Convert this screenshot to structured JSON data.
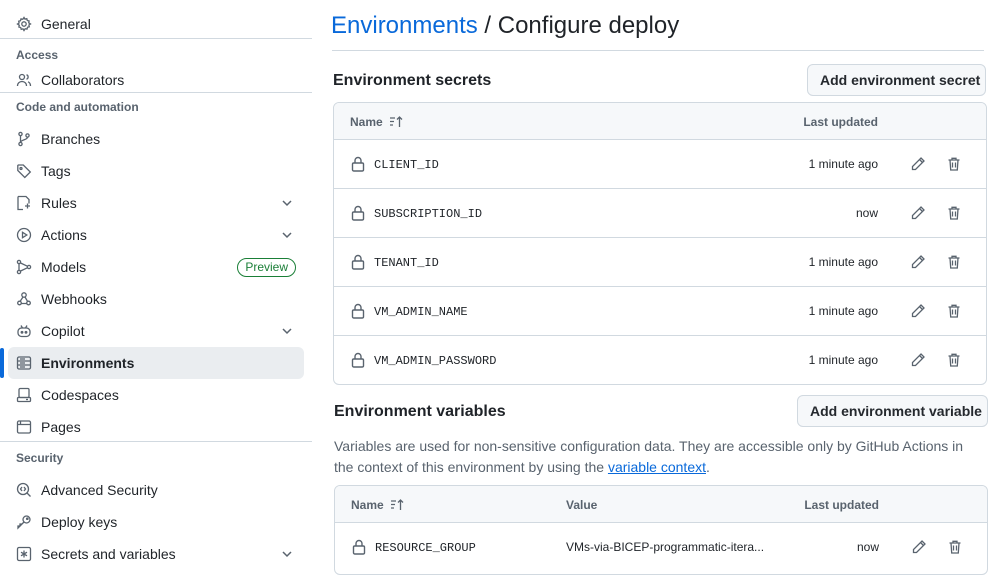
{
  "sidebar": {
    "items": [
      {
        "label": "General",
        "icon": "gear-icon"
      },
      {
        "label": "Collaborators",
        "icon": "people-icon"
      },
      {
        "label": "Branches",
        "icon": "git-branch-icon"
      },
      {
        "label": "Tags",
        "icon": "tag-icon"
      },
      {
        "label": "Rules",
        "icon": "rules-icon"
      },
      {
        "label": "Actions",
        "icon": "play-icon"
      },
      {
        "label": "Models",
        "icon": "models-icon",
        "badge": "Preview"
      },
      {
        "label": "Webhooks",
        "icon": "webhook-icon"
      },
      {
        "label": "Copilot",
        "icon": "copilot-icon"
      },
      {
        "label": "Environments",
        "icon": "server-icon"
      },
      {
        "label": "Codespaces",
        "icon": "codespaces-icon"
      },
      {
        "label": "Pages",
        "icon": "browser-icon"
      },
      {
        "label": "Advanced Security",
        "icon": "codescan-icon"
      },
      {
        "label": "Deploy keys",
        "icon": "key-icon"
      },
      {
        "label": "Secrets and variables",
        "icon": "asterisk-icon"
      }
    ],
    "groups": {
      "access": "Access",
      "code_automation": "Code and automation",
      "security": "Security"
    }
  },
  "header": {
    "crumb": "Environments",
    "separator": " / ",
    "title": "Configure deploy"
  },
  "secrets": {
    "title": "Environment secrets",
    "add_label": "Add environment secret",
    "col_name": "Name",
    "col_updated": "Last updated",
    "rows": [
      {
        "name": "CLIENT_ID",
        "updated": "1 minute ago"
      },
      {
        "name": "SUBSCRIPTION_ID",
        "updated": "now"
      },
      {
        "name": "TENANT_ID",
        "updated": "1 minute ago"
      },
      {
        "name": "VM_ADMIN_NAME",
        "updated": "1 minute ago"
      },
      {
        "name": "VM_ADMIN_PASSWORD",
        "updated": "1 minute ago"
      }
    ]
  },
  "variables": {
    "title": "Environment variables",
    "add_label": "Add environment variable",
    "desc_before": "Variables are used for non-sensitive configuration data. They are accessible only by GitHub Actions in the context of this environment by using the ",
    "desc_link": "variable context",
    "desc_after": ".",
    "col_name": "Name",
    "col_value": "Value",
    "col_updated": "Last updated",
    "rows": [
      {
        "name": "RESOURCE_GROUP",
        "value": "VMs-via-BICEP-programmatic-itera...",
        "updated": "now"
      }
    ]
  }
}
